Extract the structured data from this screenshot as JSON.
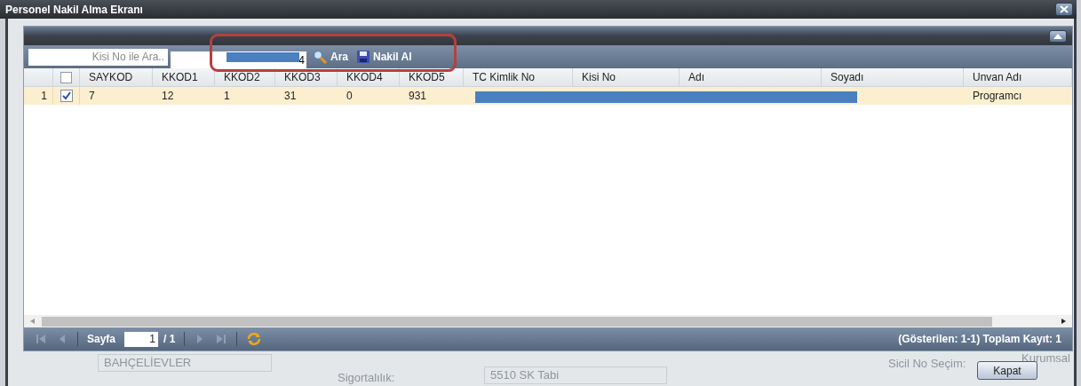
{
  "window": {
    "title": "Personel Nakil Alma Ekranı"
  },
  "toolbar": {
    "search": {
      "placeholder": "Kisi No ile Ara.."
    },
    "query": {
      "value": "4",
      "redacted": true
    },
    "buttons": [
      {
        "label": "Ara",
        "kind": "search"
      },
      {
        "label": "Nakil Al",
        "kind": "save"
      }
    ],
    "highlighted": true
  },
  "table": {
    "columns": [
      "SAYKOD",
      "KKOD1",
      "KKOD2",
      "KKOD3",
      "KKOD4",
      "KKOD5",
      "TC Kimlik No",
      "Kisi No",
      "Adı",
      "Soyadı",
      "Unvan Adı"
    ],
    "header_checked": false,
    "rows": [
      {
        "number": "1",
        "selected": true,
        "checked": true,
        "cells": [
          "7",
          "12",
          "1",
          "31",
          "0",
          "931",
          null,
          null,
          null,
          null,
          "Programcı"
        ],
        "redacted": true
      }
    ]
  },
  "pager": {
    "label": "Sayfa",
    "page": "1",
    "total": "/ 1",
    "summary": "(Gösterilen: 1-1) Toplam Kayıt: 1"
  },
  "background": {
    "texts": [
      "BAHÇELİEVLER",
      "Sigortalılık:",
      "5510 SK Tabi",
      "Sicil No Seçim:",
      "Kurumsal"
    ]
  },
  "close_button": "Kapat"
}
